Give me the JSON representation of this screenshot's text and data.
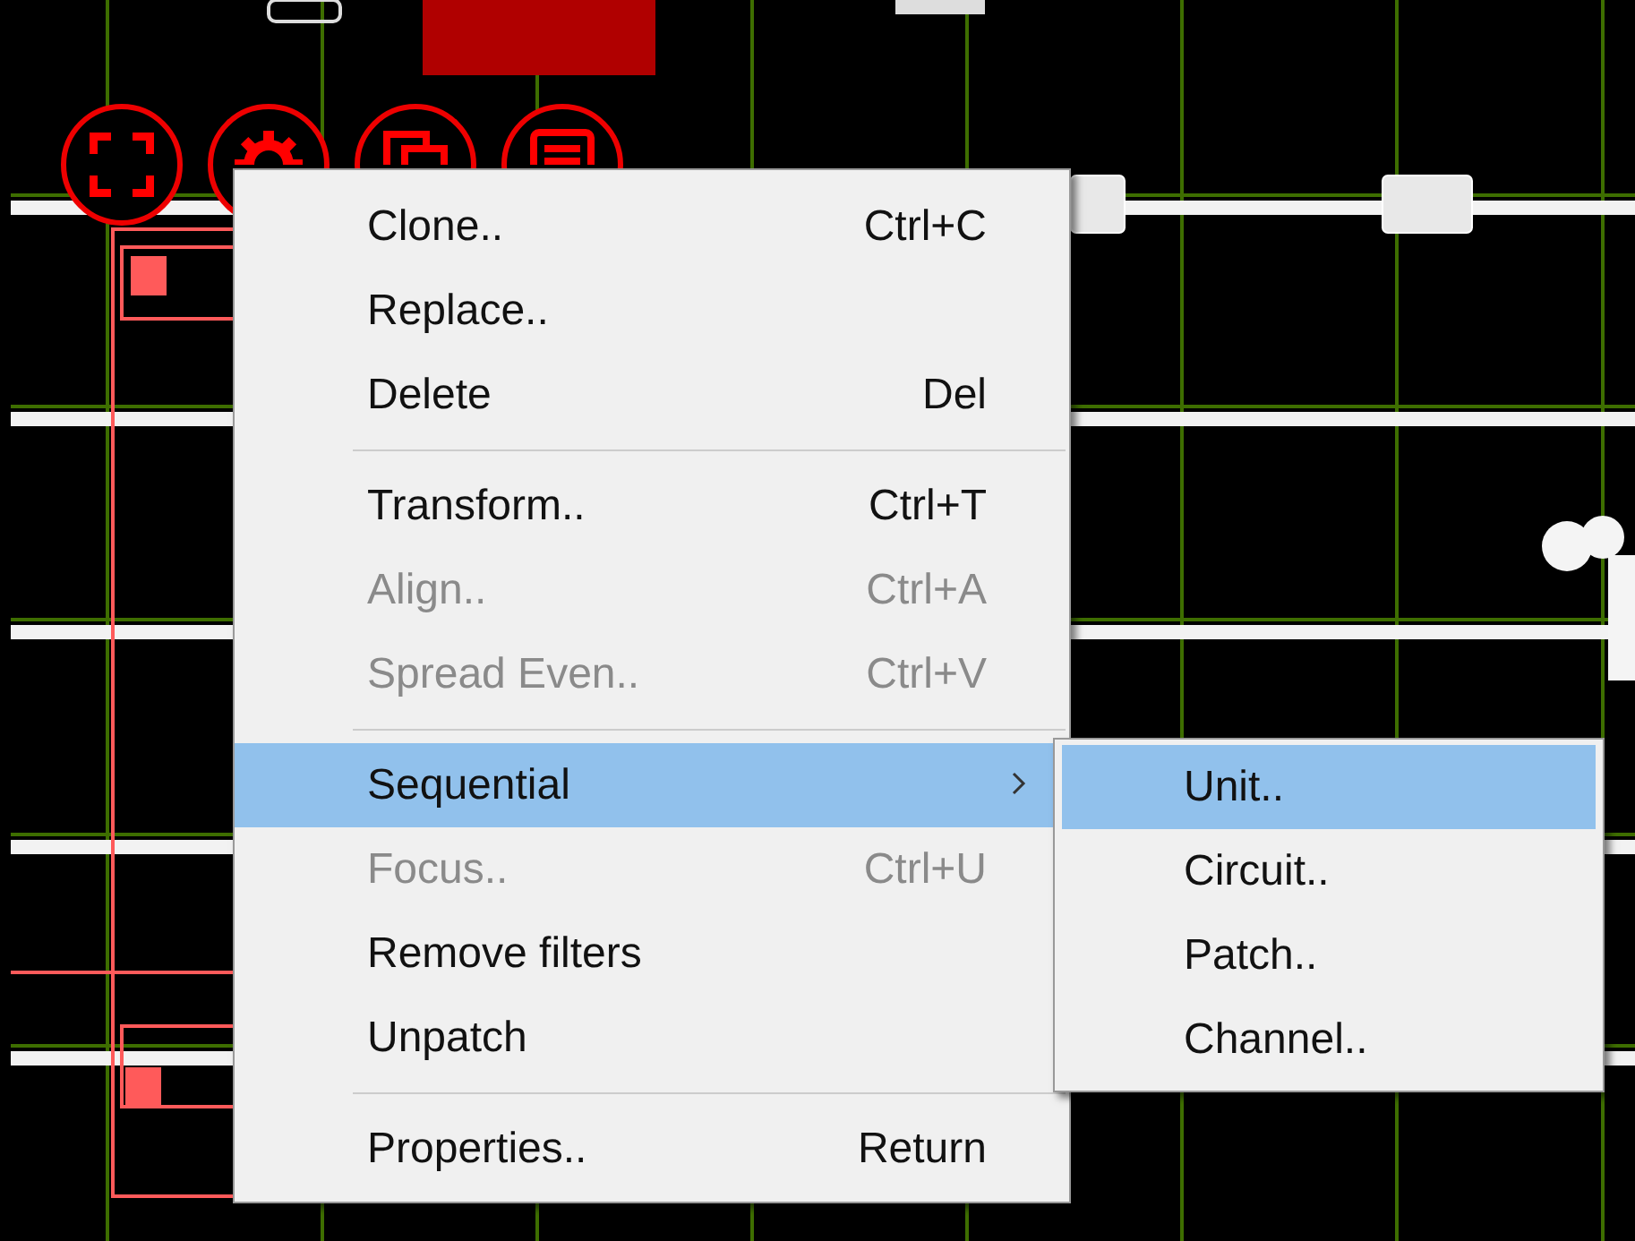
{
  "context_menu": {
    "sections": [
      [
        {
          "label": "Clone..",
          "shortcut": "Ctrl+C",
          "disabled": false,
          "selected": false,
          "has_submenu": false
        },
        {
          "label": "Replace..",
          "disabled": false,
          "selected": false,
          "has_submenu": false
        },
        {
          "label": "Delete",
          "shortcut": "Del",
          "disabled": false,
          "selected": false,
          "has_submenu": false
        }
      ],
      [
        {
          "label": "Transform..",
          "shortcut": "Ctrl+T",
          "disabled": false,
          "selected": false,
          "has_submenu": false
        },
        {
          "label": "Align..",
          "shortcut": "Ctrl+A",
          "disabled": true,
          "selected": false,
          "has_submenu": false
        },
        {
          "label": "Spread Even..",
          "shortcut": "Ctrl+V",
          "disabled": true,
          "selected": false,
          "has_submenu": false
        }
      ],
      [
        {
          "label": "Sequential",
          "disabled": false,
          "selected": true,
          "has_submenu": true
        },
        {
          "label": "Focus..",
          "shortcut": "Ctrl+U",
          "disabled": true,
          "selected": false,
          "has_submenu": false
        },
        {
          "label": "Remove filters",
          "disabled": false,
          "selected": false,
          "has_submenu": false
        },
        {
          "label": "Unpatch",
          "disabled": false,
          "selected": false,
          "has_submenu": false
        }
      ],
      [
        {
          "label": "Properties..",
          "shortcut": "Return",
          "disabled": false,
          "selected": false,
          "has_submenu": false
        }
      ]
    ]
  },
  "submenu": {
    "items": [
      {
        "label": "Unit..",
        "selected": true
      },
      {
        "label": "Circuit..",
        "selected": false
      },
      {
        "label": "Patch..",
        "selected": false
      },
      {
        "label": "Channel..",
        "selected": false
      }
    ]
  }
}
